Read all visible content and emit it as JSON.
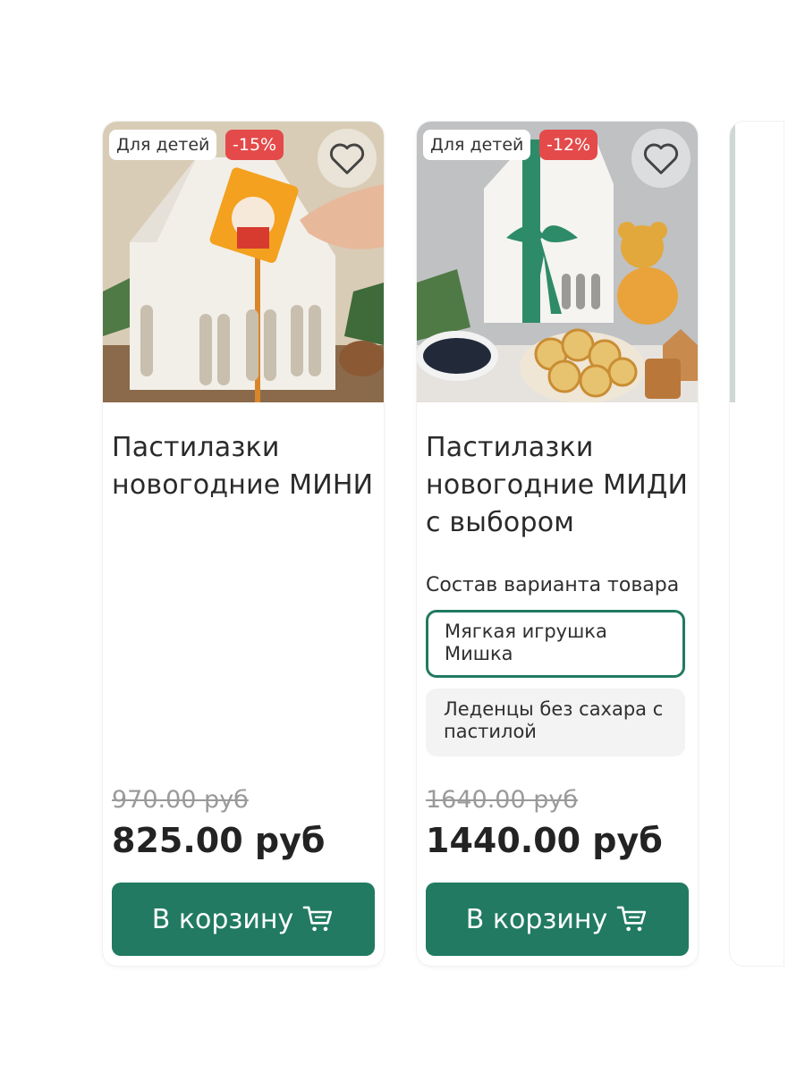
{
  "products": [
    {
      "tag": "Для детей",
      "discount": "-15%",
      "title": "Пастилазки новогодние МИНИ",
      "old_price": "970.00 руб",
      "price": "825.00 руб",
      "cart_label": "В корзину",
      "favorite_icon": "heart-icon",
      "cart_icon": "cart-icon"
    },
    {
      "tag": "Для детей",
      "discount": "-12%",
      "title": "Пастилазки новогодние МИДИ с выбором",
      "variant_label": "Состав варианта товара",
      "variants": [
        {
          "label": "Мягкая игрушка Мишка",
          "selected": true
        },
        {
          "label": "Леденцы без сахара с пастилой",
          "selected": false
        }
      ],
      "old_price": "1640.00 руб",
      "price": "1440.00 руб",
      "cart_label": "В корзину",
      "favorite_icon": "heart-icon",
      "cart_icon": "cart-icon"
    }
  ],
  "colors": {
    "accent": "#217a61",
    "sale_badge": "#e44a4a",
    "old_price": "#9a9a9a"
  }
}
